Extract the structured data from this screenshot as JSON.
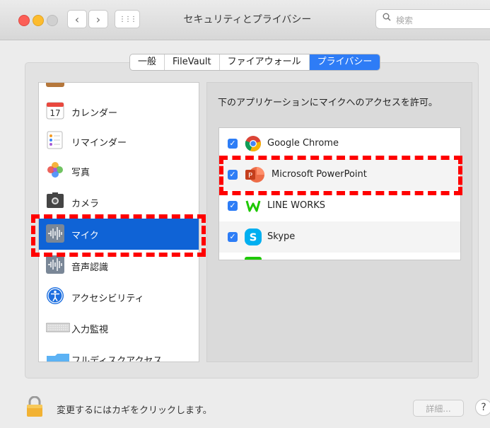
{
  "window": {
    "title": "セキュリティとプライバシー"
  },
  "nav": {
    "back": "‹",
    "forward": "›",
    "grid": "⋮⋮⋮"
  },
  "search": {
    "placeholder": "検索",
    "icon": "search-icon"
  },
  "tabs": [
    {
      "label": "一般",
      "active": false
    },
    {
      "label": "FileVault",
      "active": false
    },
    {
      "label": "ファイアウォール",
      "active": false
    },
    {
      "label": "プライバシー",
      "active": true
    }
  ],
  "sidebar": {
    "items": [
      {
        "label": "カレンダー",
        "icon": "calendar-icon"
      },
      {
        "label": "リマインダー",
        "icon": "reminders-icon"
      },
      {
        "label": "写真",
        "icon": "photos-icon"
      },
      {
        "label": "カメラ",
        "icon": "camera-icon"
      },
      {
        "label": "マイク",
        "icon": "microphone-icon",
        "selected": true
      },
      {
        "label": "音声認識",
        "icon": "speech-recognition-icon"
      },
      {
        "label": "アクセシビリティ",
        "icon": "accessibility-icon"
      },
      {
        "label": "入力監視",
        "icon": "keyboard-icon"
      },
      {
        "label": "フルディスクアクセス",
        "icon": "folder-icon"
      }
    ]
  },
  "main": {
    "description": "下のアプリケーションにマイクへのアクセスを許可。",
    "apps": [
      {
        "name": "Google Chrome",
        "checked": true,
        "icon": "chrome-icon"
      },
      {
        "name": "Microsoft PowerPoint",
        "checked": true,
        "icon": "powerpoint-icon"
      },
      {
        "name": "LINE WORKS",
        "checked": true,
        "icon": "line-works-icon"
      },
      {
        "name": "Skype",
        "checked": true,
        "icon": "skype-icon"
      }
    ]
  },
  "calendar_day": "17",
  "footer": {
    "lock_text": "変更するにはカギをクリックします。",
    "details_label": "詳細...",
    "help_label": "?"
  },
  "colors": {
    "accent": "#2e7cf6",
    "selection": "#0f63d6",
    "highlight": "#ff0000"
  }
}
